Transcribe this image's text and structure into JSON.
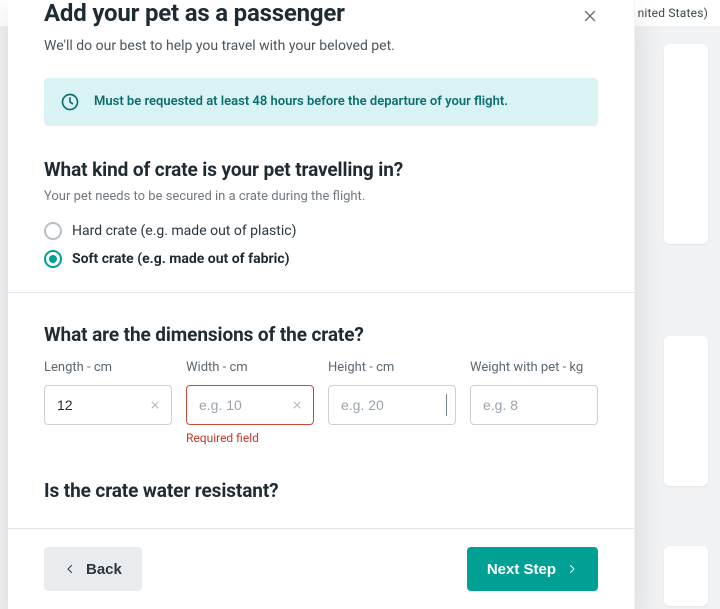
{
  "bg": {
    "locale_fragment": "nited States)"
  },
  "modal": {
    "title": "Add your pet as a passenger",
    "subtitle": "We'll do our best to help you travel with your beloved pet.",
    "alert": "Must be requested at least 48 hours before the departure of your flight.",
    "crate_section": {
      "title": "What kind of crate is your pet travelling in?",
      "hint": "Your pet needs to be secured in a crate during the flight.",
      "options": {
        "hard": "Hard crate (e.g. made out of plastic)",
        "soft": "Soft crate (e.g. made out of fabric)"
      },
      "selected": "soft"
    },
    "dims_section": {
      "title": "What are the dimensions of the crate?",
      "fields": {
        "length": {
          "label": "Length - cm",
          "value": "12",
          "placeholder": ""
        },
        "width": {
          "label": "Width - cm",
          "value": "",
          "placeholder": "e.g. 10",
          "error": "Required field"
        },
        "height": {
          "label": "Height - cm",
          "value": "",
          "placeholder": "e.g. 20"
        },
        "weight": {
          "label": "Weight with pet - kg",
          "value": "",
          "placeholder": "e.g. 8"
        }
      }
    },
    "water_section": {
      "title": "Is the crate water resistant?"
    },
    "footer": {
      "back": "Back",
      "next": "Next Step"
    }
  }
}
